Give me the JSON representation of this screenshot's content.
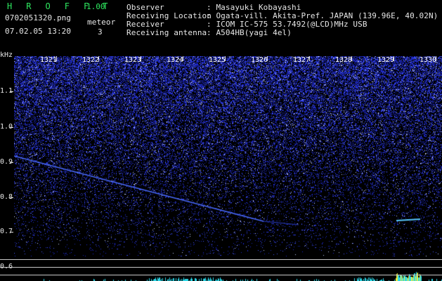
{
  "header": {
    "app_title": "H R O F F T",
    "app_version": "1.00",
    "filename": "0702051320.png",
    "datetime": "07.02.05 13:20",
    "meteor_label": "meteor",
    "meteor_count": "3",
    "info": [
      {
        "label": "Observer",
        "value": ": Masayuki Kobayashi"
      },
      {
        "label": "Receiving Location",
        "value": ": Ogata-vill. Akita-Pref. JAPAN (139.96E, 40.02N)"
      },
      {
        "label": "Receiver",
        "value": ": ICOM IC-575 53.7492(@LCD)MHz USB"
      },
      {
        "label": "Receiving antenna",
        "value": ": A504HB(yagi 4el)"
      }
    ]
  },
  "axes": {
    "y_unit": "kHz",
    "y_ticks": [
      "1.1",
      "1.0",
      "0.9",
      "0.8",
      "0.7",
      "0.6"
    ],
    "x_ticks": [
      "1321",
      "1322",
      "1323",
      "1324",
      "1325",
      "1326",
      "1327",
      "1328",
      "1329",
      "1330"
    ]
  },
  "colors": {
    "background": "#000000",
    "title_green": "#2ee860",
    "noise_blue": "#2a3cff",
    "trace_blue": "#4a6bff",
    "trace_light": "#58c8ff",
    "power_cyan": "#2ad8e8",
    "power_yellow": "#f0f040"
  }
}
